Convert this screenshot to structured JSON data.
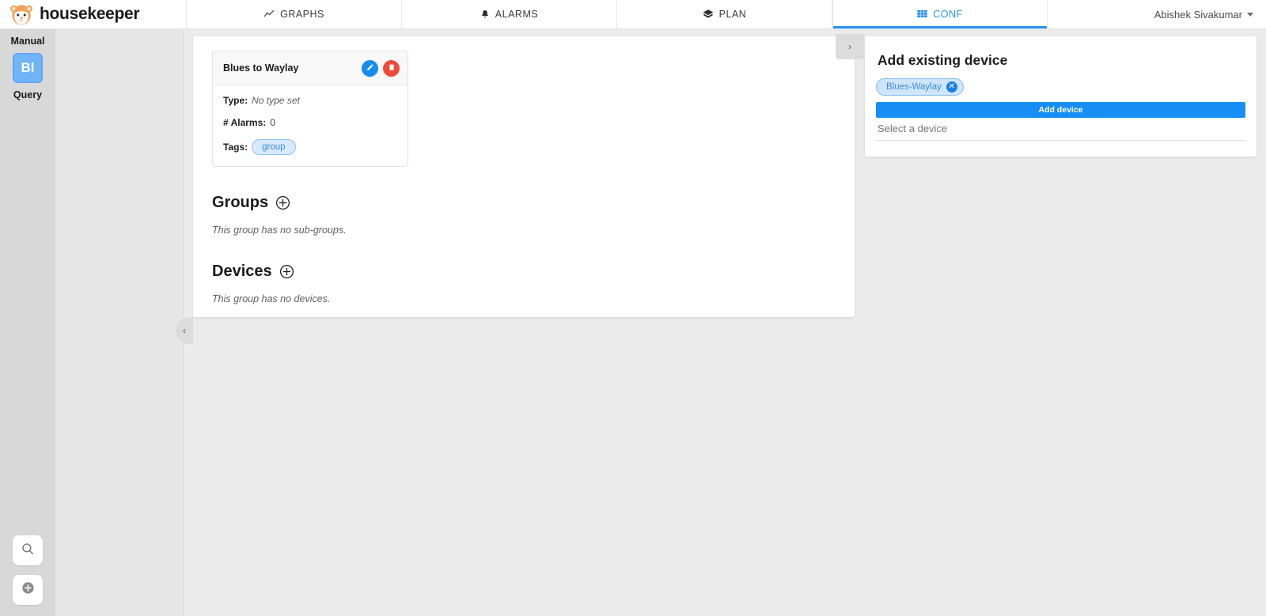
{
  "header": {
    "brand": "housekeeper",
    "logo_icon": "hamster-mascot-logo",
    "tabs": [
      {
        "label": "GRAPHS",
        "icon": "line-chart-icon",
        "active": false
      },
      {
        "label": "ALARMS",
        "icon": "bell-icon",
        "active": false
      },
      {
        "label": "PLAN",
        "icon": "layers-icon",
        "active": false
      },
      {
        "label": "CONF",
        "icon": "grid-icon",
        "active": true
      }
    ],
    "user": {
      "name": "Abishek Sivakumar",
      "caret_icon": "chevron-down-icon"
    },
    "accent_color": "#2a92f4"
  },
  "sidebar": {
    "manual_label": "Manual",
    "tile_label": "Bl",
    "query_label": "Query",
    "tile_color": "#72b4f8",
    "buttons": [
      {
        "name": "search",
        "icon": "search-icon"
      },
      {
        "name": "add",
        "icon": "plus-circle-icon"
      }
    ]
  },
  "main": {
    "group_card": {
      "title": "Blues to Waylay",
      "edit_icon": "pencil-icon",
      "delete_icon": "trash-icon",
      "edit_color": "#168cf3",
      "delete_color": "#ee4b3a",
      "fields": [
        {
          "key": "Type:",
          "value": "No type set",
          "italic": true
        },
        {
          "key": "# Alarms:",
          "value": "0",
          "italic": false
        }
      ],
      "tags_label": "Tags:",
      "tags": [
        "group"
      ]
    },
    "sections": [
      {
        "title": "Groups",
        "add_icon": "plus-circle-outline-icon",
        "empty_text": "This group has no sub-groups."
      },
      {
        "title": "Devices",
        "add_icon": "plus-circle-outline-icon",
        "empty_text": "This group has no devices."
      }
    ],
    "handles": {
      "left": "‹",
      "right": "›"
    }
  },
  "right_panel": {
    "title": "Add existing device",
    "selected_chip": {
      "label": "Blues-Waylay",
      "remove_icon": "close-circle-icon"
    },
    "add_button_label": "Add device",
    "add_button_color": "#178ef5",
    "select_placeholder": "Select a device"
  }
}
